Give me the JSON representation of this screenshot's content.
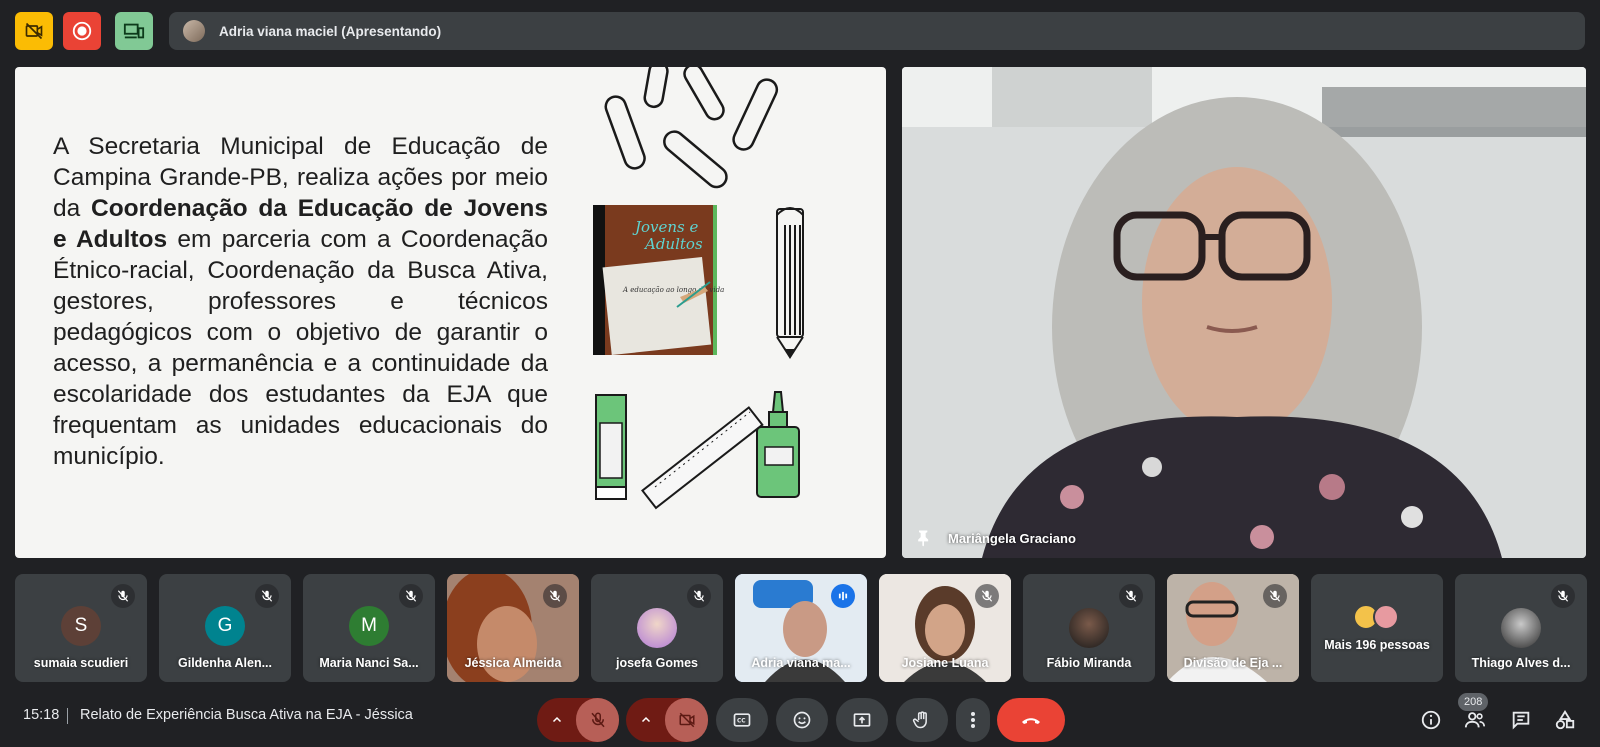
{
  "topbar": {
    "presenter_label": "Adria viana maciel (Apresentando)"
  },
  "slide": {
    "text_part1": "A Secretaria Municipal de Educação de Campina Grande-PB, realiza ações por meio da ",
    "text_bold": "Coordenação da Educação de Jovens e Adultos",
    "text_part2": " em parceria com a Coordenação Étnico-racial, Coordenação da Busca Ativa, gestores, professores e técnicos pedagógicos com o objetivo de garantir o acesso, a permanência e a continuidade da escolaridade dos estudantes da EJA que frequentam as unidades educacionais do município.",
    "book_title_line1": "Jovens e",
    "book_title_line2": "Adultos",
    "book_caption": "A educação ao longo da vida"
  },
  "main_video": {
    "name": "Mariângela Graciano"
  },
  "participants": [
    {
      "name": "sumaia scudieri",
      "initial": "S",
      "color": "#5d4037",
      "type": "initial"
    },
    {
      "name": "Gildenha Alen...",
      "initial": "G",
      "color": "#00838f",
      "type": "initial"
    },
    {
      "name": "Maria Nanci Sa...",
      "initial": "M",
      "color": "#2e7d32",
      "type": "initial"
    },
    {
      "name": "Jéssica Almeida",
      "type": "video"
    },
    {
      "name": "josefa Gomes",
      "type": "photo"
    },
    {
      "name": "Adria viana ma...",
      "type": "video",
      "active": true
    },
    {
      "name": "Josiane Luana",
      "type": "video"
    },
    {
      "name": "Fábio Miranda",
      "type": "photo"
    },
    {
      "name": "Divisão de Eja ...",
      "type": "video"
    },
    {
      "name": "Mais 196 pessoas",
      "type": "more"
    },
    {
      "name": "Thiago Alves d...",
      "type": "photo"
    }
  ],
  "bottombar": {
    "time": "15:18",
    "meeting_title": "Relato de Experiência Busca Ativa na EJA - Jéssica",
    "participant_count": "208"
  },
  "colors": {
    "background": "#202124",
    "tile": "#3c4043",
    "hangup": "#ea4335",
    "active_outline": "#8ab4f8"
  }
}
